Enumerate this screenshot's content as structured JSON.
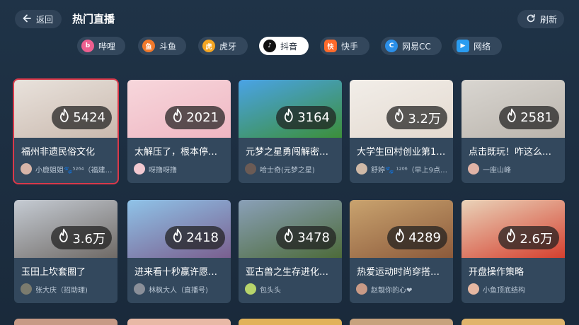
{
  "header": {
    "back_label": "返回",
    "title": "热门直播",
    "refresh_label": "刷新"
  },
  "tabs": [
    {
      "label": "哔哩",
      "icon": "bilibili-icon",
      "color": "#ee5f8f",
      "active": false
    },
    {
      "label": "斗鱼",
      "icon": "douyu-icon",
      "color": "#f0792b",
      "active": false
    },
    {
      "label": "虎牙",
      "icon": "huya-icon",
      "color": "#f5a623",
      "active": false
    },
    {
      "label": "抖音",
      "icon": "douyin-icon",
      "color": "#111111",
      "active": true
    },
    {
      "label": "快手",
      "icon": "kuaishou-icon",
      "color": "#ff6a2b",
      "active": false
    },
    {
      "label": "网易CC",
      "icon": "netease-cc-icon",
      "color": "#2b8fe8",
      "active": false
    },
    {
      "label": "网络",
      "icon": "network-icon",
      "color": "#2a9cf0",
      "active": false
    }
  ],
  "cards": [
    {
      "title": "福州非遗民俗文化",
      "viewers": "5424",
      "streamer": "小鹿姐姐🐾⁵²⁶⁴（福建…",
      "selected": true,
      "thumb": [
        "#e9e2dc",
        "#c9b9ae"
      ],
      "avatar": "#d7b5a8"
    },
    {
      "title": "太解压了，根本停…",
      "viewers": "2021",
      "streamer": "呀撸呀撸",
      "selected": false,
      "thumb": [
        "#f7d7dc",
        "#efb6c2"
      ],
      "avatar": "#f2c9d1"
    },
    {
      "title": "元梦之星勇闯解密…",
      "viewers": "3164",
      "streamer": "哈士奇(元梦之星)",
      "selected": false,
      "thumb": [
        "#4aa3e6",
        "#3c8f3a"
      ],
      "avatar": "#6b5b55"
    },
    {
      "title": "大学生回村创业第1…",
      "viewers": "3.2万",
      "streamer": "舒婷🐾 ¹²⁰⁶（早上9点…",
      "selected": false,
      "thumb": [
        "#f2eee9",
        "#e3d9cf"
      ],
      "avatar": "#cfb9a7"
    },
    {
      "title": "点击既玩！咋这么…",
      "viewers": "2581",
      "streamer": "一座山峰",
      "selected": false,
      "thumb": [
        "#d9d6d1",
        "#b9b3ab"
      ],
      "avatar": "#e0b3a6"
    },
    {
      "title": "玉田上坎套圈了",
      "viewers": "3.6万",
      "streamer": "张大庆（招助理)",
      "selected": false,
      "thumb": [
        "#c5cbd3",
        "#6f6a66"
      ],
      "avatar": "#7b7b6e"
    },
    {
      "title": "进来看十秒赢许愿…",
      "viewers": "2418",
      "streamer": "林枫大人（直播号)",
      "selected": false,
      "thumb": [
        "#8fc3e8",
        "#7a5f8f"
      ],
      "avatar": "#8a8f99"
    },
    {
      "title": "亚古兽之生存进化…",
      "viewers": "3478",
      "streamer": "包头头",
      "selected": false,
      "thumb": [
        "#8aa0b8",
        "#4d6b3a"
      ],
      "avatar": "#b7d46b"
    },
    {
      "title": "热爱运动时尚穿搭…",
      "viewers": "4289",
      "streamer": "赵靓你的心❤",
      "selected": false,
      "thumb": [
        "#c9a36f",
        "#8c5a3b"
      ],
      "avatar": "#c99a86"
    },
    {
      "title": "开盘操作策略",
      "viewers": "2.6万",
      "streamer": "小鱼顶底结构",
      "selected": false,
      "thumb": [
        "#e9d3b9",
        "#d5402f"
      ],
      "avatar": "#e6b8a2"
    }
  ],
  "bottom_row_colors": [
    "#c79a86",
    "#e8b9a6",
    "#e1b25a",
    "#c7a27d",
    "#e0b46b"
  ]
}
